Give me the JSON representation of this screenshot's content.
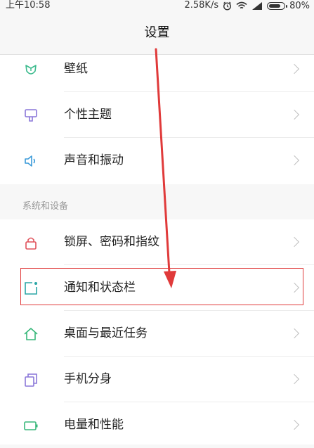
{
  "status_bar": {
    "time": "上午10:58",
    "network_speed": "2.58K/s",
    "battery_percent": "80%",
    "icons": [
      "alarm-icon",
      "wifi-icon",
      "signal-icon",
      "battery-icon"
    ]
  },
  "header": {
    "title": "设置"
  },
  "group1": {
    "items": [
      {
        "label": "壁纸",
        "icon": "wallpaper-icon",
        "icon_color": "#3dbb8e"
      },
      {
        "label": "个性主题",
        "icon": "theme-icon",
        "icon_color": "#8a77d9"
      },
      {
        "label": "声音和振动",
        "icon": "sound-icon",
        "icon_color": "#3a9ad9"
      }
    ]
  },
  "group2": {
    "section_label": "系统和设备",
    "items": [
      {
        "label": "锁屏、密码和指纹",
        "icon": "lock-icon",
        "icon_color": "#e0525b"
      },
      {
        "label": "通知和状态栏",
        "icon": "notification-icon",
        "icon_color": "#2aa6a6"
      },
      {
        "label": "桌面与最近任务",
        "icon": "home-icon",
        "icon_color": "#38b77a"
      },
      {
        "label": "手机分身",
        "icon": "dual-app-icon",
        "icon_color": "#8a77d9"
      },
      {
        "label": "电量和性能",
        "icon": "battery-performance-icon",
        "icon_color": "#38b77a"
      }
    ]
  },
  "annotation": {
    "color": "#e03a3a"
  }
}
